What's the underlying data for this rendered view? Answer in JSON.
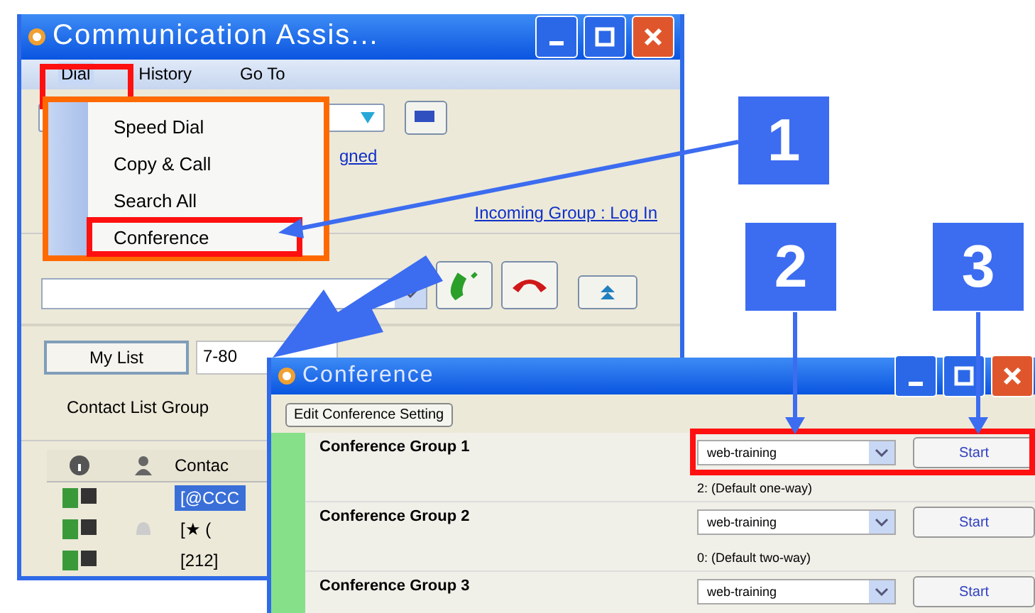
{
  "main_window": {
    "title": "Communication Assis...",
    "menu": [
      {
        "label": "Dial",
        "selected": true
      },
      {
        "label": "History",
        "selected": false
      },
      {
        "label": "Go To",
        "selected": false
      }
    ],
    "assigned_link": "gned",
    "incoming_link": "Incoming Group : Log In",
    "tabs": [
      {
        "label": "My List",
        "selected": false
      },
      {
        "label": "7-80",
        "selected": true
      }
    ],
    "group_label": "Contact List Group",
    "contact_column": "Contac",
    "rows": [
      {
        "contact": "[@CCC",
        "selected": true,
        "alert": false
      },
      {
        "contact": "[★ (",
        "selected": false,
        "alert": true
      },
      {
        "contact": "[212]",
        "selected": false,
        "alert": false
      }
    ]
  },
  "dial_menu": {
    "items": [
      {
        "label": "Speed Dial",
        "selected": false
      },
      {
        "label": "Copy & Call",
        "selected": false
      },
      {
        "label": "Search All",
        "selected": false
      },
      {
        "label": "Conference",
        "selected": true
      }
    ]
  },
  "conference_window": {
    "title": "Conference",
    "edit_button": "Edit Conference Setting",
    "groups": [
      {
        "name": "Conference Group 1",
        "mode": "web-training",
        "note": "2: (Default one-way)",
        "start": "Start"
      },
      {
        "name": "Conference Group 2",
        "mode": "web-training",
        "note": "0: (Default two-way)",
        "start": "Start"
      },
      {
        "name": "Conference Group 3",
        "mode": "web-training",
        "start": "Start"
      }
    ]
  },
  "callouts": [
    "1",
    "2",
    "3"
  ]
}
